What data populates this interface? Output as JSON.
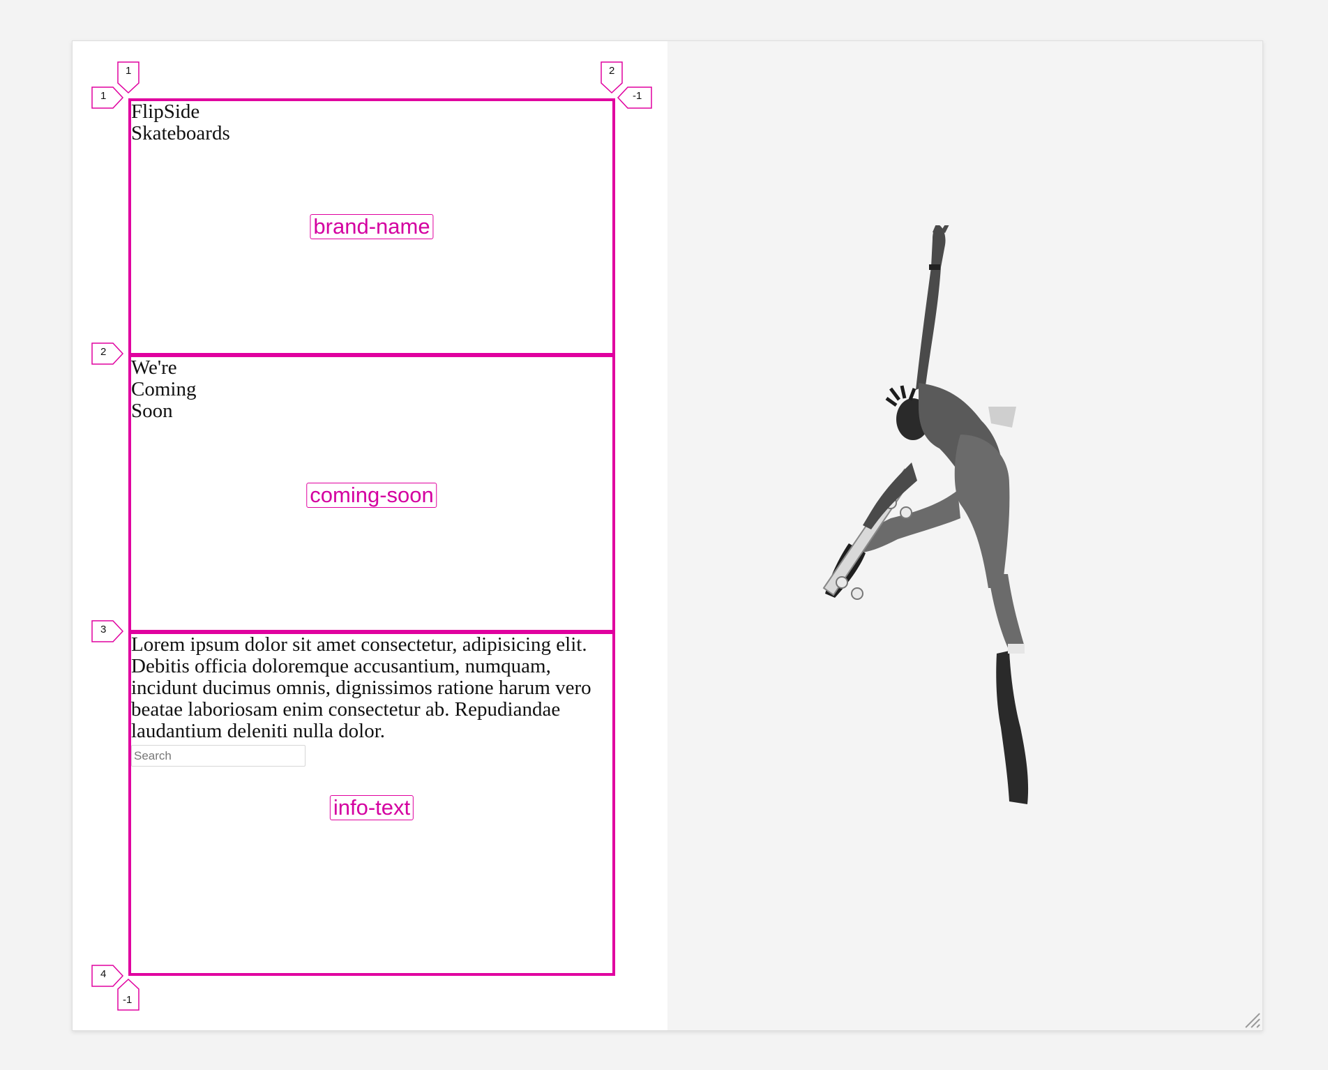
{
  "sections": {
    "brand": {
      "text": "FlipSide\nSkateboards",
      "area_label": "brand-name"
    },
    "coming_soon": {
      "text": "We're\nComing\nSoon",
      "area_label": "coming-soon"
    },
    "info": {
      "text": "Lorem ipsum dolor sit amet consectetur, adipisicing elit. Debitis officia doloremque accusantium, numquam, incidunt ducimus omnis, dignissimos ratione harum vero beatae laboriosam enim consectetur ab. Repudiandae laudantium deleniti nulla dolor.",
      "search_placeholder": "Search",
      "area_label": "info-text"
    }
  },
  "grid_line_badges": {
    "columns_top": [
      "1",
      "2"
    ],
    "rows_left": [
      "1",
      "2",
      "3",
      "4"
    ],
    "negative_right": "-1",
    "negative_bottom": "-1"
  },
  "colors": {
    "grid_overlay": "#e0009f",
    "background": "#f3f3f3"
  },
  "image": {
    "description_icon": "skateboarder-photo"
  }
}
